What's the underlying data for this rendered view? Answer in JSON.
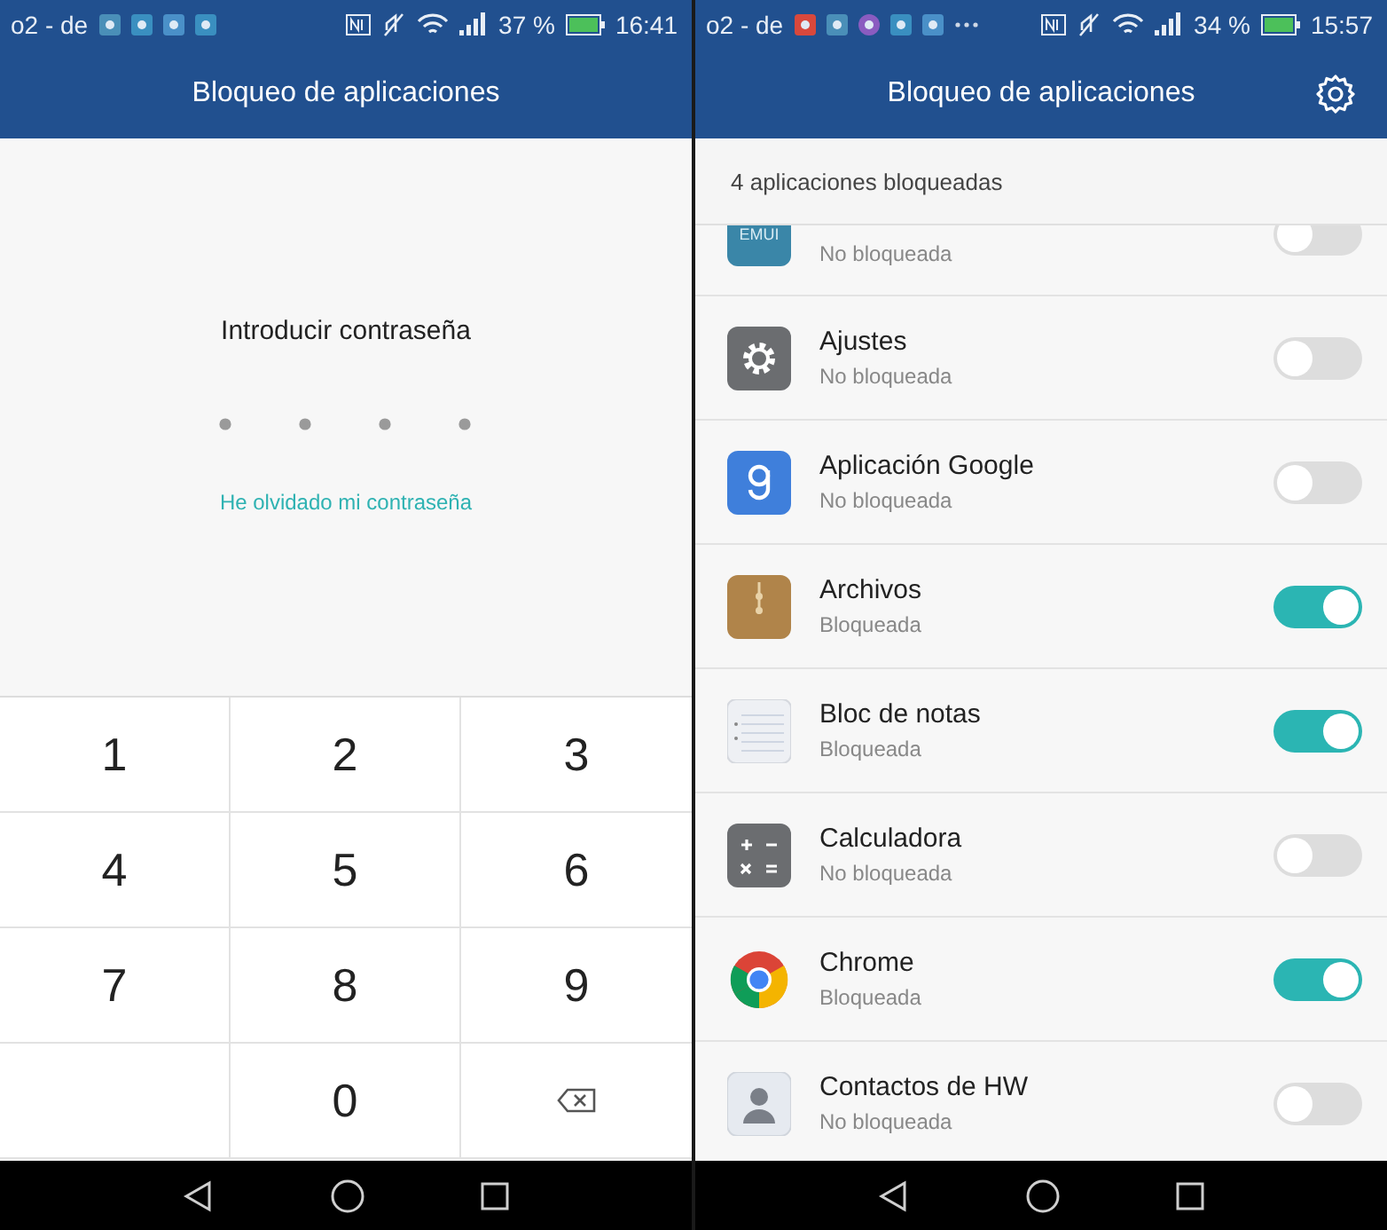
{
  "screens": [
    {
      "status_bar": {
        "carrier": "o2 - de",
        "battery": "37 %",
        "time": "16:41"
      },
      "title": "Bloqueo de aplicaciones",
      "kind": "pin",
      "prompt": "Introducir contraseña",
      "forgot_link": "He olvidado mi contraseña",
      "keys": [
        {
          "kind": "digit",
          "label": "1"
        },
        {
          "kind": "digit",
          "label": "2"
        },
        {
          "kind": "digit",
          "label": "3"
        },
        {
          "kind": "digit",
          "label": "4"
        },
        {
          "kind": "digit",
          "label": "5"
        },
        {
          "kind": "digit",
          "label": "6"
        },
        {
          "kind": "digit",
          "label": "7"
        },
        {
          "kind": "digit",
          "label": "8"
        },
        {
          "kind": "digit",
          "label": "9"
        },
        {
          "kind": "blank"
        },
        {
          "kind": "digit",
          "label": "0"
        },
        {
          "kind": "backspace"
        }
      ]
    },
    {
      "status_bar": {
        "carrier": "o2 - de",
        "battery": "34 %",
        "time": "15:57"
      },
      "title": "Bloqueo de aplicaciones",
      "kind": "list",
      "summary": "4 aplicaciones bloqueadas",
      "apps": [
        {
          "kind": "emui",
          "icon_text": "EMUI",
          "status": "No bloqueada",
          "on": false
        },
        {
          "kind": "settings",
          "name": "Ajustes",
          "status": "No bloqueada",
          "on": false
        },
        {
          "kind": "google",
          "name": "Aplicación Google",
          "status": "No bloqueada",
          "on": false
        },
        {
          "kind": "files",
          "name": "Archivos",
          "status": "Bloqueada",
          "on": true
        },
        {
          "kind": "notes",
          "name": "Bloc de notas",
          "status": "Bloqueada",
          "on": true
        },
        {
          "kind": "calculator",
          "name": "Calculadora",
          "status": "No bloqueada",
          "on": false
        },
        {
          "kind": "chrome",
          "name": "Chrome",
          "status": "Bloqueada",
          "on": true
        },
        {
          "kind": "contacts",
          "name": "Contactos de HW",
          "status": "No bloqueada",
          "on": false
        }
      ]
    }
  ]
}
